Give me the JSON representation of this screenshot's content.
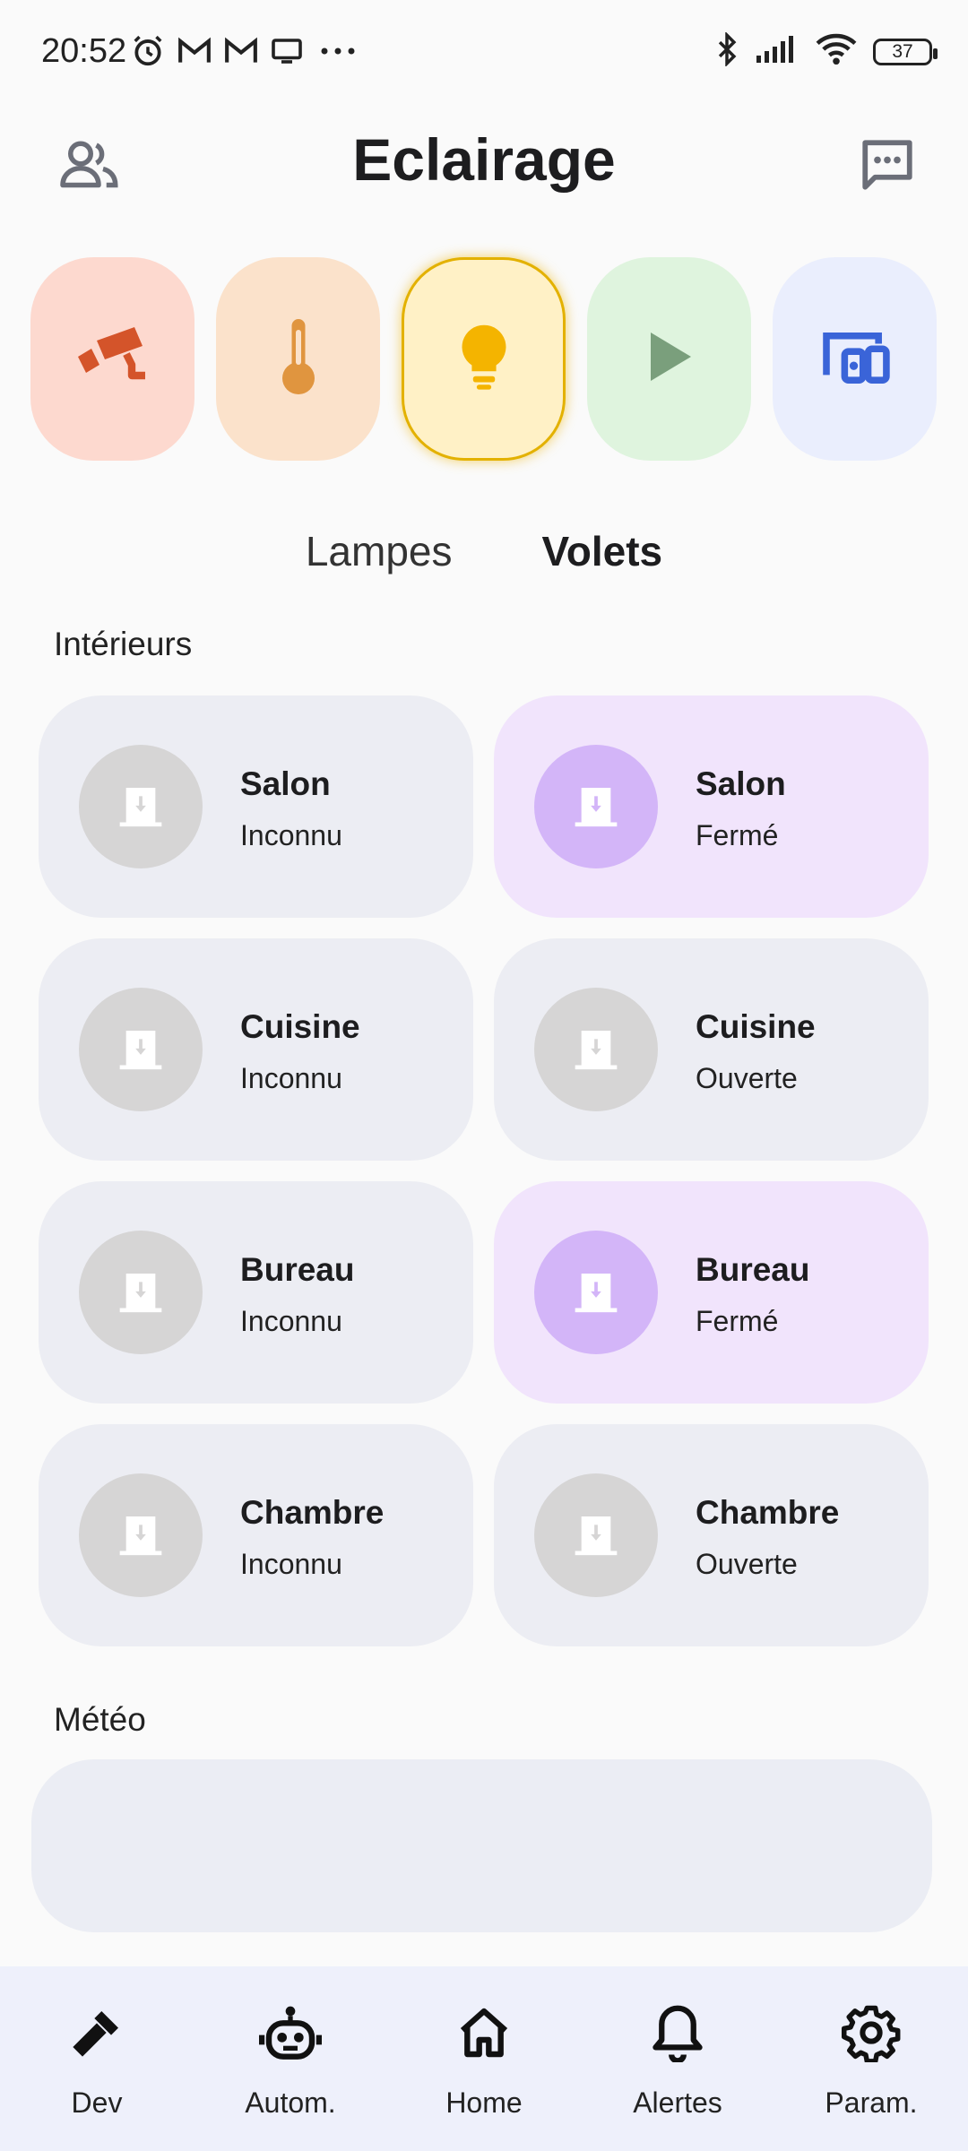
{
  "status_bar": {
    "time": "20:52",
    "battery": "37",
    "left_icons": [
      "alarm-icon",
      "gmail-icon",
      "gmail-icon",
      "screen-icon",
      "more-dots-icon"
    ],
    "right_icons": [
      "bluetooth-icon",
      "signal-icon",
      "wifi-icon",
      "battery-icon"
    ]
  },
  "header": {
    "title": "Eclairage",
    "left_icon": "people-icon",
    "right_icon": "message-icon"
  },
  "categories": [
    {
      "icon": "camera-icon",
      "bg": "#fdd9cf",
      "color": "#d4542a",
      "active": false
    },
    {
      "icon": "thermometer-icon",
      "bg": "#fbe2cb",
      "color": "#e0953f",
      "active": false
    },
    {
      "icon": "lightbulb-icon",
      "bg": "#fff1c6",
      "color": "#f4b400",
      "active": true
    },
    {
      "icon": "play-icon",
      "bg": "#dff4de",
      "color": "#7a9f7c",
      "active": false
    },
    {
      "icon": "devices-icon",
      "bg": "#eaeefd",
      "color": "#3a64d8",
      "active": false
    }
  ],
  "tabs": [
    {
      "label": "Lampes",
      "selected": false
    },
    {
      "label": "Volets",
      "selected": true
    }
  ],
  "sections": {
    "interior_title": "Intérieurs",
    "weather_title": "Météo"
  },
  "devices": [
    {
      "name": "Salon",
      "state": "Inconnu",
      "closed": false
    },
    {
      "name": "Salon",
      "state": "Fermé",
      "closed": true
    },
    {
      "name": "Cuisine",
      "state": "Inconnu",
      "closed": false
    },
    {
      "name": "Cuisine",
      "state": "Ouverte",
      "closed": false
    },
    {
      "name": "Bureau",
      "state": "Inconnu",
      "closed": false
    },
    {
      "name": "Bureau",
      "state": "Fermé",
      "closed": true
    },
    {
      "name": "Chambre",
      "state": "Inconnu",
      "closed": false
    },
    {
      "name": "Chambre",
      "state": "Ouverte",
      "closed": false
    }
  ],
  "bottom_nav": [
    {
      "label": "Dev",
      "icon": "hammer-icon"
    },
    {
      "label": "Autom.",
      "icon": "robot-icon"
    },
    {
      "label": "Home",
      "icon": "home-icon"
    },
    {
      "label": "Alertes",
      "icon": "bell-icon"
    },
    {
      "label": "Param.",
      "icon": "gear-icon"
    }
  ]
}
